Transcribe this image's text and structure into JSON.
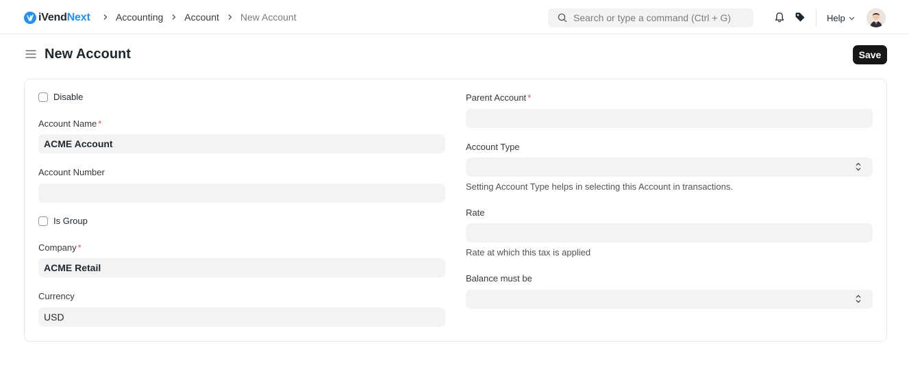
{
  "navbar": {
    "brand_prefix": "iVend",
    "brand_suffix": "Next",
    "breadcrumbs": [
      "Accounting",
      "Account",
      "New Account"
    ],
    "search_placeholder": "Search or type a command (Ctrl + G)",
    "help_label": "Help"
  },
  "page": {
    "title": "New Account",
    "save_label": "Save"
  },
  "form": {
    "left": {
      "disable_label": "Disable",
      "disable_checked": false,
      "account_name_label": "Account Name",
      "account_name_value": "ACME Account",
      "account_number_label": "Account Number",
      "account_number_value": "",
      "is_group_label": "Is Group",
      "is_group_checked": false,
      "company_label": "Company",
      "company_value": "ACME Retail",
      "currency_label": "Currency",
      "currency_value": "USD",
      "required_marker": "*"
    },
    "right": {
      "parent_account_label": "Parent Account",
      "parent_account_value": "",
      "account_type_label": "Account Type",
      "account_type_value": "",
      "account_type_hint": "Setting Account Type helps in selecting this Account in transactions.",
      "rate_label": "Rate",
      "rate_value": "",
      "rate_hint": "Rate at which this tax is applied",
      "balance_label": "Balance must be",
      "balance_value": ""
    }
  },
  "colors": {
    "brand_blue": "#2490ef",
    "required_red": "#e24c4c",
    "primary_button": "#171717",
    "field_bg": "#f3f3f3"
  },
  "icons": [
    "logo-icon",
    "chevron-right-icon",
    "search-icon",
    "bell-icon",
    "tag-icon",
    "chevron-down-icon",
    "user-avatar",
    "menu-icon",
    "select-arrows-icon"
  ]
}
